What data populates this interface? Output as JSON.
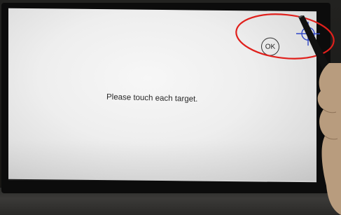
{
  "calibration": {
    "instruction": "Please touch each target.",
    "ok_label": "OK"
  },
  "icons": {
    "target": "crosshair-target-icon"
  },
  "colors": {
    "screen": "#eeeeee",
    "text": "#2a2a2a",
    "annotation": "#e0201c",
    "target": "#2f47c8"
  }
}
